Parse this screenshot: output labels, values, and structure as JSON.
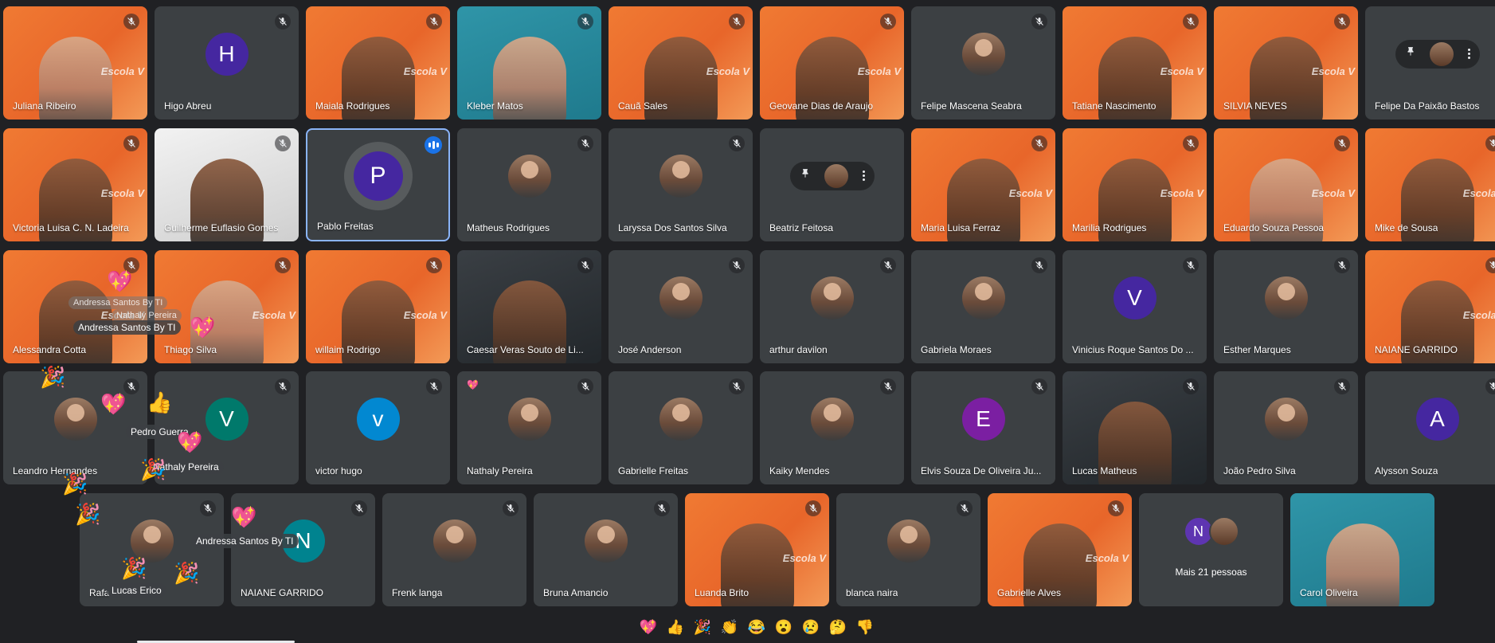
{
  "colors": {
    "background": "#202124",
    "tile": "#3c4043",
    "orange_video": "#f07a33",
    "speaking_blue": "#1a73e8",
    "active_border": "#8ab4f8"
  },
  "watermark_text": "Escola V",
  "tiles": [
    {
      "name": "Juliana Ribeiro",
      "kind": "video",
      "theme": "orange",
      "row": 0,
      "col": 0
    },
    {
      "name": "Higo Abreu",
      "kind": "avatar",
      "initial": "H",
      "color": "#4527a0",
      "row": 0,
      "col": 1
    },
    {
      "name": "Maiala Rodrigues",
      "kind": "video",
      "theme": "orange",
      "row": 0,
      "col": 2
    },
    {
      "name": "Kleber Matos",
      "kind": "video",
      "theme": "teal",
      "row": 0,
      "col": 3
    },
    {
      "name": "Cauã Sales",
      "kind": "video",
      "theme": "orange",
      "row": 0,
      "col": 4
    },
    {
      "name": "Geovane Dias de Araujo",
      "kind": "video",
      "theme": "orange",
      "row": 0,
      "col": 5
    },
    {
      "name": "Felipe Mascena Seabra",
      "kind": "photo",
      "row": 0,
      "col": 6
    },
    {
      "name": "Tatiane Nascimento",
      "kind": "video",
      "theme": "orange",
      "row": 0,
      "col": 7
    },
    {
      "name": "SILVIA NEVES",
      "kind": "video",
      "theme": "orange",
      "row": 0,
      "col": 8
    },
    {
      "name": "Felipe Da Paixão Bastos",
      "kind": "pinned",
      "row": 0,
      "col": 9
    },
    {
      "name": "Victoria Luisa C. N. Ladeira",
      "kind": "video",
      "theme": "orange",
      "row": 1,
      "col": 0
    },
    {
      "name": "Guilherme Euflasio Gomes",
      "kind": "video",
      "theme": "white",
      "row": 1,
      "col": 1
    },
    {
      "name": "Pablo Freitas",
      "kind": "avatar-speaking",
      "initial": "P",
      "color": "#4527a0",
      "row": 1,
      "col": 2
    },
    {
      "name": "Matheus Rodrigues",
      "kind": "photo",
      "row": 1,
      "col": 3
    },
    {
      "name": "Laryssa Dos Santos Silva",
      "kind": "photo",
      "row": 1,
      "col": 4
    },
    {
      "name": "Beatriz Feitosa",
      "kind": "pinned",
      "row": 1,
      "col": 5
    },
    {
      "name": "Maria Luisa Ferraz",
      "kind": "video",
      "theme": "orange",
      "row": 1,
      "col": 6
    },
    {
      "name": "Marilia Rodrigues",
      "kind": "video",
      "theme": "orange",
      "row": 1,
      "col": 7
    },
    {
      "name": "Eduardo Souza Pessoa",
      "kind": "video",
      "theme": "orange",
      "row": 1,
      "col": 8
    },
    {
      "name": "Mike de Sousa",
      "kind": "video",
      "theme": "orange",
      "row": 1,
      "col": 9
    },
    {
      "name": "Alessandra Cotta",
      "kind": "video",
      "theme": "orange",
      "row": 2,
      "col": 0
    },
    {
      "name": "Thiago Silva",
      "kind": "video",
      "theme": "orange",
      "row": 2,
      "col": 1
    },
    {
      "name": "willaim Rodrigo",
      "kind": "video",
      "theme": "orange",
      "row": 2,
      "col": 2
    },
    {
      "name": "Caesar Veras Souto de Li...",
      "kind": "video",
      "theme": "dark",
      "row": 2,
      "col": 3
    },
    {
      "name": "José Anderson",
      "kind": "photo",
      "row": 2,
      "col": 4
    },
    {
      "name": "arthur davilon",
      "kind": "photo",
      "row": 2,
      "col": 5
    },
    {
      "name": "Gabriela Moraes",
      "kind": "photo",
      "row": 2,
      "col": 6
    },
    {
      "name": "Vinicius Roque Santos Do ...",
      "kind": "avatar",
      "initial": "V",
      "color": "#4527a0",
      "row": 2,
      "col": 7
    },
    {
      "name": "Esther Marques",
      "kind": "photo",
      "row": 2,
      "col": 8
    },
    {
      "name": "NAIANE GARRIDO",
      "kind": "video",
      "theme": "orange",
      "row": 2,
      "col": 9
    },
    {
      "name": "Leandro Hernandes",
      "kind": "photo",
      "row": 3,
      "col": 0
    },
    {
      "name": "",
      "kind": "avatar",
      "initial": "V",
      "color": "#00796b",
      "row": 3,
      "col": 1
    },
    {
      "name": "victor hugo",
      "kind": "avatar",
      "initial": "v",
      "color": "#0288d1",
      "row": 3,
      "col": 2
    },
    {
      "name": "Nathaly Pereira",
      "kind": "photo",
      "badge": "💖",
      "row": 3,
      "col": 3
    },
    {
      "name": "Gabrielle Freitas",
      "kind": "photo",
      "row": 3,
      "col": 4
    },
    {
      "name": "Kaiky Mendes",
      "kind": "photo",
      "row": 3,
      "col": 5
    },
    {
      "name": "Elvis Souza De Oliveira Ju...",
      "kind": "avatar",
      "initial": "E",
      "color": "#7b1fa2",
      "row": 3,
      "col": 6
    },
    {
      "name": "Lucas Matheus",
      "kind": "video",
      "theme": "dark",
      "row": 3,
      "col": 7
    },
    {
      "name": "João Pedro Silva",
      "kind": "photo",
      "row": 3,
      "col": 8
    },
    {
      "name": "Alysson Souza",
      "kind": "avatar",
      "initial": "A",
      "color": "#4527a0",
      "row": 3,
      "col": 9
    },
    {
      "name": "Rafa",
      "kind": "photo",
      "row": 4,
      "col": 0
    },
    {
      "name": "NAIANE GARRIDO",
      "kind": "avatar",
      "initial": "N",
      "color": "#00838f",
      "row": 4,
      "col": 1
    },
    {
      "name": "Frenk langa",
      "kind": "photo",
      "row": 4,
      "col": 2
    },
    {
      "name": "Bruna Amancio",
      "kind": "photo",
      "row": 4,
      "col": 3
    },
    {
      "name": "Luanda Brito",
      "kind": "video",
      "theme": "orange",
      "row": 4,
      "col": 4
    },
    {
      "name": "blanca naira",
      "kind": "photo",
      "row": 4,
      "col": 5
    },
    {
      "name": "Gabrielle Alves",
      "kind": "video",
      "theme": "orange",
      "row": 4,
      "col": 6
    },
    {
      "name": "",
      "kind": "more",
      "more_label": "Mais 21 pessoas",
      "initial": "N",
      "row": 4,
      "col": 7
    },
    {
      "name": "Carol Oliveira",
      "kind": "video",
      "theme": "teal",
      "row": 4,
      "col": 8
    }
  ],
  "floating_labels": [
    {
      "text": "Andressa Santos By TI",
      "ghost": true
    },
    {
      "text": "Nathaly Pereira",
      "ghost": true
    },
    {
      "text": "Andressa Santos By TI",
      "ghost": false
    },
    {
      "text": "Pedro Guerra",
      "ghost": false
    },
    {
      "text": "Nathaly Pereira",
      "ghost": false
    },
    {
      "text": "Andressa Santos By TI",
      "ghost": false
    },
    {
      "text": "Lucas Erico",
      "ghost": false
    }
  ],
  "floating_emojis": [
    "💖",
    "🎉",
    "💖",
    "👍",
    "💖",
    "🎉",
    "🎉",
    "🎉",
    "💖",
    "🎉",
    "🎉",
    "💖"
  ],
  "reactions": [
    {
      "emoji": "💖",
      "name": "heart"
    },
    {
      "emoji": "👍",
      "name": "thumbs-up"
    },
    {
      "emoji": "🎉",
      "name": "party"
    },
    {
      "emoji": "👏",
      "name": "clap"
    },
    {
      "emoji": "😂",
      "name": "laugh"
    },
    {
      "emoji": "😮",
      "name": "surprised"
    },
    {
      "emoji": "😢",
      "name": "sad"
    },
    {
      "emoji": "🤔",
      "name": "thinking"
    },
    {
      "emoji": "👎",
      "name": "thumbs-down"
    }
  ]
}
